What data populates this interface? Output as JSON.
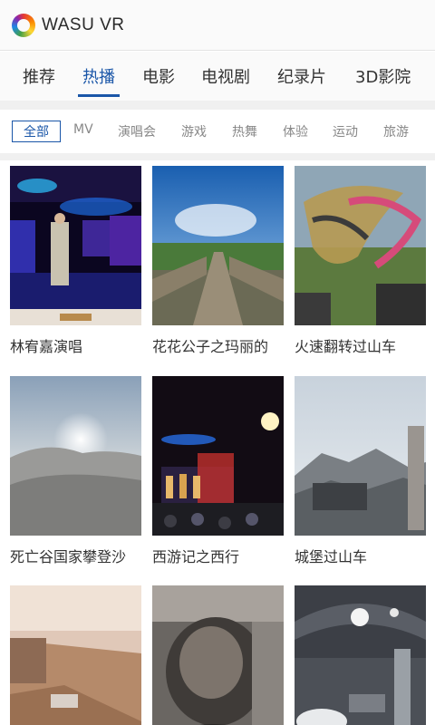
{
  "header": {
    "brand": "WASU VR",
    "logo_icon": "wasu-logo-icon"
  },
  "main_tabs": [
    "推荐",
    "热播",
    "电影",
    "电视剧",
    "纪录片",
    "3D影院"
  ],
  "main_tab_active": 1,
  "sub_tabs": [
    "全部",
    "MV",
    "演唱会",
    "游戏",
    "热舞",
    "体验",
    "运动",
    "旅游"
  ],
  "sub_tab_active": 0,
  "videos": [
    {
      "title": "林宥嘉演唱",
      "scene": "concert-stage"
    },
    {
      "title": "花花公子之玛丽的",
      "scene": "wooden-bridge"
    },
    {
      "title": "火速翻转过山车",
      "scene": "roller-coaster-flip"
    },
    {
      "title": "死亡谷国家攀登沙",
      "scene": "desert-dunes"
    },
    {
      "title": "西游记之西行",
      "scene": "theater-performance"
    },
    {
      "title": "城堡过山车",
      "scene": "castle-mountains"
    },
    {
      "title": "",
      "scene": "mars-terrain"
    },
    {
      "title": "",
      "scene": "rock-tunnel"
    },
    {
      "title": "",
      "scene": "exhibition-hall"
    }
  ],
  "colors": {
    "accent": "#1a56a8",
    "inactive_text": "#888888",
    "divider": "#f0f0f0"
  }
}
